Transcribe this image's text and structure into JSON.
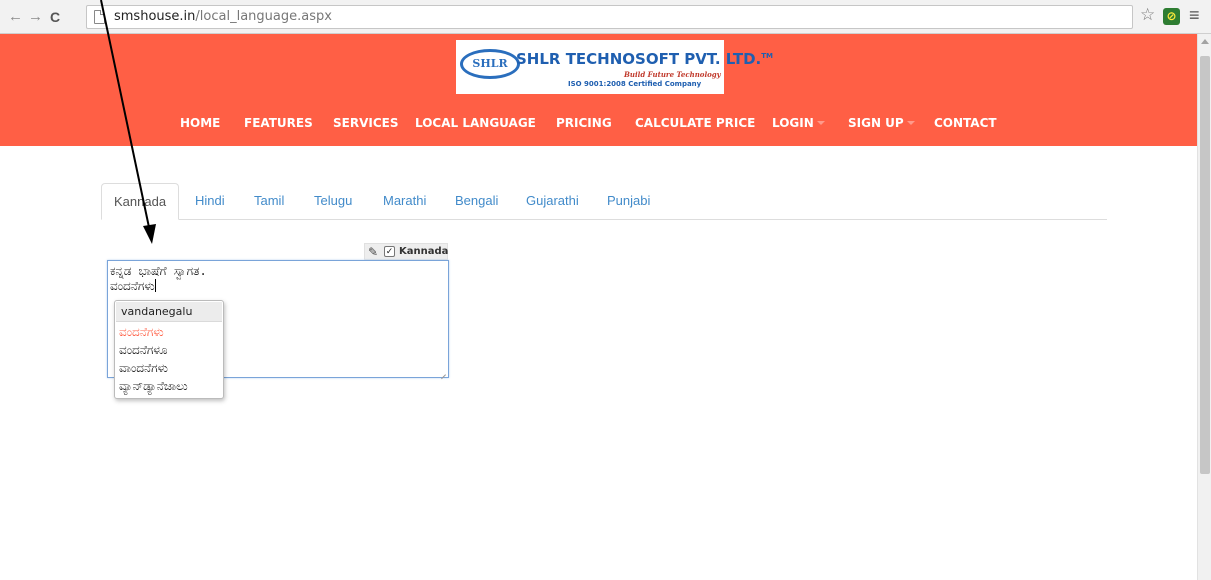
{
  "browser": {
    "back_glyph": "←",
    "forward_glyph": "→",
    "reload_glyph": "C",
    "url_host": "smshouse.in",
    "url_path": "/local_language.aspx",
    "star_glyph": "☆",
    "extension_glyph": "⊘",
    "menu_glyph": "≡"
  },
  "logo": {
    "emblem": "SHLR",
    "company": "SHLR TECHNOSOFT PVT. LTD.",
    "trademark": "TM",
    "tagline": "Build Future Technology",
    "iso": "ISO 9001:2008 Certified Company"
  },
  "nav": {
    "items": [
      {
        "label": "HOME",
        "dropdown": false
      },
      {
        "label": "FEATURES",
        "dropdown": false
      },
      {
        "label": "SERVICES",
        "dropdown": false
      },
      {
        "label": "LOCAL LANGUAGE",
        "dropdown": false
      },
      {
        "label": "PRICING",
        "dropdown": false
      },
      {
        "label": "CALCULATE PRICE",
        "dropdown": false
      },
      {
        "label": "LOGIN",
        "dropdown": true
      },
      {
        "label": "SIGN UP",
        "dropdown": true
      },
      {
        "label": "CONTACT",
        "dropdown": false
      }
    ]
  },
  "tabs": {
    "active": "Kannada",
    "items": [
      "Kannada",
      "Hindi",
      "Tamil",
      "Telugu",
      "Marathi",
      "Bengali",
      "Gujarathi",
      "Punjabi"
    ]
  },
  "transliteration": {
    "pencil_glyph": "✎",
    "checked": true,
    "check_glyph": "✓",
    "language": "Kannada"
  },
  "editor": {
    "lines": [
      "ಕನ್ನಡ ಭಾಷೆಗೆ ಸ್ವಾಗತ.",
      "ವಂದನೆಗಳು"
    ]
  },
  "suggestions": {
    "input": "vandanegalu",
    "selected_index": 0,
    "options": [
      "ವಂದನೆಗಳು",
      "ವಂದನೆಗಳೂ",
      "ವಾಂದನೆಗಳು",
      "ವ್ಯಾನ್‌ಡ್ಯಾನೆಜಾಲು"
    ]
  },
  "colors": {
    "header_bg": "#ff5f45",
    "link": "#428bca",
    "suggest_selected": "#ff5f45"
  }
}
